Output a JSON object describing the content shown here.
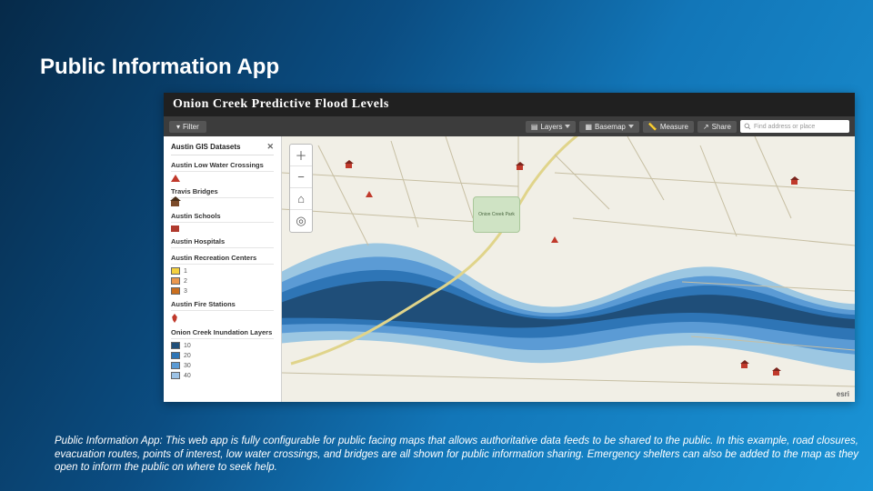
{
  "slide": {
    "title": "Public Information App",
    "caption": "Public Information App: This web app is fully configurable for public facing maps that allows authoritative data feeds to be shared to the public. In this example, road closures, evacuation routes, points of interest, low water crossings, and bridges are all shown for public information sharing. Emergency shelters can also be added to the map as they open to inform the public on where to seek help."
  },
  "app": {
    "title": "Onion Creek Predictive Flood Levels",
    "toolbar": {
      "filter": "Filter",
      "layers": "Layers",
      "basemap": "Basemap",
      "measure": "Measure",
      "share": "Share",
      "search_placeholder": "Find address or place"
    },
    "sidebar": {
      "heading": "Austin GIS Datasets",
      "close": "✕",
      "layers": [
        {
          "name": "Austin Low Water Crossings",
          "items": [
            {
              "icon": "warning-triangle-icon",
              "label": ""
            }
          ]
        },
        {
          "name": "Travis Bridges",
          "items": [
            {
              "icon": "house-icon",
              "label": ""
            }
          ]
        },
        {
          "name": "Austin Schools",
          "items": [
            {
              "icon": "school-icon",
              "label": ""
            }
          ]
        },
        {
          "name": "Austin Hospitals",
          "items": []
        },
        {
          "name": "Austin Recreation Centers",
          "items": [
            {
              "swatch": "#f4d03f",
              "label": "1"
            },
            {
              "swatch": "#eb984e",
              "label": "2"
            },
            {
              "swatch": "#ca6f1e",
              "label": "3"
            }
          ]
        },
        {
          "name": "Austin Fire Stations",
          "items": [
            {
              "icon": "flame-icon",
              "label": ""
            }
          ]
        },
        {
          "name": "Onion Creek Inundation Layers",
          "items": [
            {
              "swatch": "#1f4e79",
              "label": "10"
            },
            {
              "swatch": "#2e75b6",
              "label": "20"
            },
            {
              "swatch": "#5b9bd5",
              "label": "30"
            },
            {
              "swatch": "#9dc3e6",
              "label": "40"
            }
          ]
        }
      ]
    },
    "map_tools": {
      "zoom_in": "＋",
      "zoom_out": "−",
      "home": "⌂",
      "locate": "◎"
    },
    "park_label": "Onion Creek Park",
    "attribution": "esri"
  }
}
